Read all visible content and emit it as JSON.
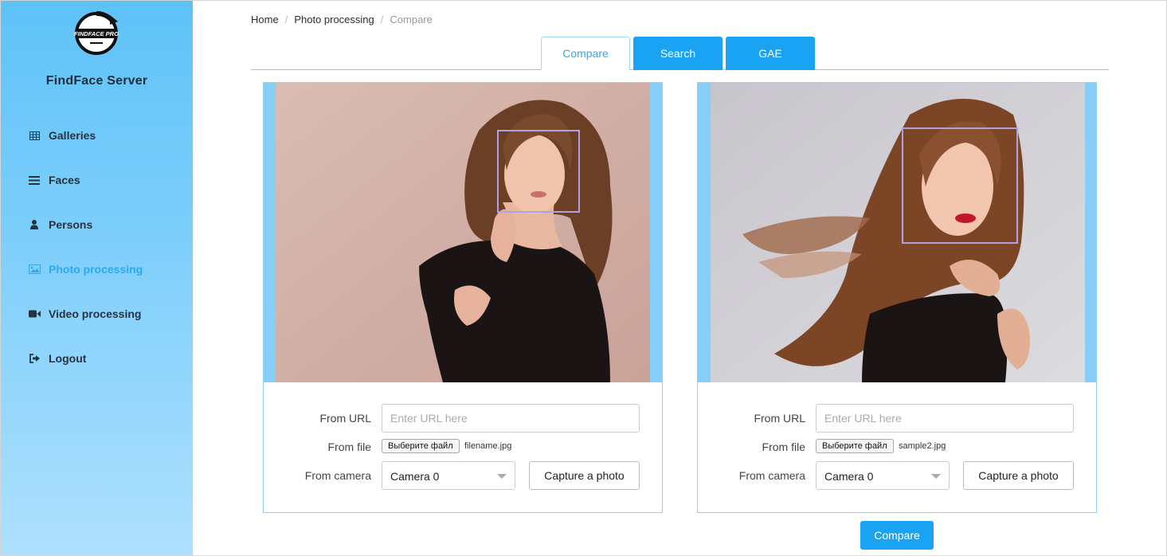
{
  "app": {
    "title": "FindFace Server",
    "logo_text": "FINDFACE PRO"
  },
  "colors": {
    "accent": "#1aa3f2",
    "sidebar_top": "#5ec2f7",
    "sidebar_bottom": "#aee0fd",
    "active_nav": "#2fa8f0",
    "face_box": "#b3a0e0"
  },
  "sidebar": {
    "items": [
      {
        "label": "Galleries",
        "icon": "table-icon",
        "active": false
      },
      {
        "label": "Faces",
        "icon": "list-icon",
        "active": false
      },
      {
        "label": "Persons",
        "icon": "user-icon",
        "active": false
      },
      {
        "label": "Photo processing",
        "icon": "image-icon",
        "active": true
      },
      {
        "label": "Video processing",
        "icon": "video-camera-icon",
        "active": false
      },
      {
        "label": "Logout",
        "icon": "sign-out-icon",
        "active": false
      }
    ]
  },
  "breadcrumb": {
    "items": [
      "Home",
      "Photo processing"
    ],
    "current": "Compare"
  },
  "tabs": [
    {
      "label": "Compare",
      "active": true
    },
    {
      "label": "Search",
      "active": false
    },
    {
      "label": "GAE",
      "active": false
    }
  ],
  "panels": [
    {
      "url_label": "From URL",
      "url_placeholder": "Enter URL here",
      "file_label": "From file",
      "file_button": "Выберите файл",
      "file_name": "filename.jpg",
      "camera_label": "From camera",
      "camera_value": "Camera 0",
      "capture_label": "Capture a photo"
    },
    {
      "url_label": "From URL",
      "url_placeholder": "Enter URL here",
      "file_label": "From file",
      "file_button": "Выберите файл",
      "file_name": "sample2.jpg",
      "camera_label": "From camera",
      "camera_value": "Camera 0",
      "capture_label": "Capture a photo"
    }
  ],
  "compare_button": "Compare"
}
